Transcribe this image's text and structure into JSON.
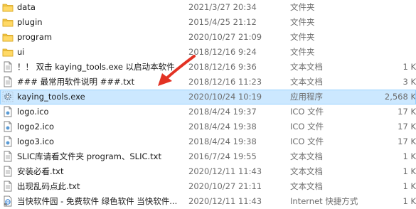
{
  "files": [
    {
      "name": "data",
      "date": "2021/3/27 20:34",
      "type": "文件夹",
      "size": "",
      "icon": "folder-icon"
    },
    {
      "name": "plugin",
      "date": "2015/4/25 21:12",
      "type": "文件夹",
      "size": "",
      "icon": "folder-icon"
    },
    {
      "name": "program",
      "date": "2020/10/27 21:09",
      "type": "文件夹",
      "size": "",
      "icon": "folder-icon"
    },
    {
      "name": "ui",
      "date": "2018/12/16 9:24",
      "type": "文件夹",
      "size": "",
      "icon": "folder-icon"
    },
    {
      "name": "！！ 双击 kaying_tools.exe 以启动本软件",
      "date": "2018/12/16 9:36",
      "type": "文本文档",
      "size": "1 K",
      "icon": "text-file-icon"
    },
    {
      "name": "### 最常用软件说明 ###.txt",
      "date": "2018/12/16 11:23",
      "type": "文本文档",
      "size": "3 K",
      "icon": "text-file-icon"
    },
    {
      "name": "kaying_tools.exe",
      "date": "2020/10/24 10:19",
      "type": "应用程序",
      "size": "2,568 K",
      "icon": "exe-gear-icon",
      "selected": true
    },
    {
      "name": "logo.ico",
      "date": "2018/4/24 19:37",
      "type": "ICO 文件",
      "size": "17 K",
      "icon": "ico-file-icon"
    },
    {
      "name": "logo2.ico",
      "date": "2018/4/24 19:38",
      "type": "ICO 文件",
      "size": "17 K",
      "icon": "ico-file-icon"
    },
    {
      "name": "logo3.ico",
      "date": "2018/4/24 19:38",
      "type": "ICO 文件",
      "size": "17 K",
      "icon": "ico-file-icon"
    },
    {
      "name": "SLIC库请看文件夹 program、SLIC.txt",
      "date": "2016/7/24 19:55",
      "type": "文本文档",
      "size": "1 K",
      "icon": "text-file-icon"
    },
    {
      "name": "安装必看.txt",
      "date": "2020/12/11 11:43",
      "type": "文本文档",
      "size": "1 K",
      "icon": "text-file-icon"
    },
    {
      "name": "出现乱码点此.txt",
      "date": "2020/10/27 21:11",
      "type": "文本文档",
      "size": "1 K",
      "icon": "text-file-icon"
    },
    {
      "name": "当快软件园 - 免费软件 绿色软件 当快软件...",
      "date": "2020/12/11 11:43",
      "type": "Internet 快捷方式",
      "size": "1 K",
      "icon": "internet-shortcut-icon"
    }
  ],
  "colors": {
    "selection_bg": "#cce8ff",
    "selection_border": "#99d1ff",
    "arrow": "#e23224",
    "folder": "#e8b936"
  }
}
